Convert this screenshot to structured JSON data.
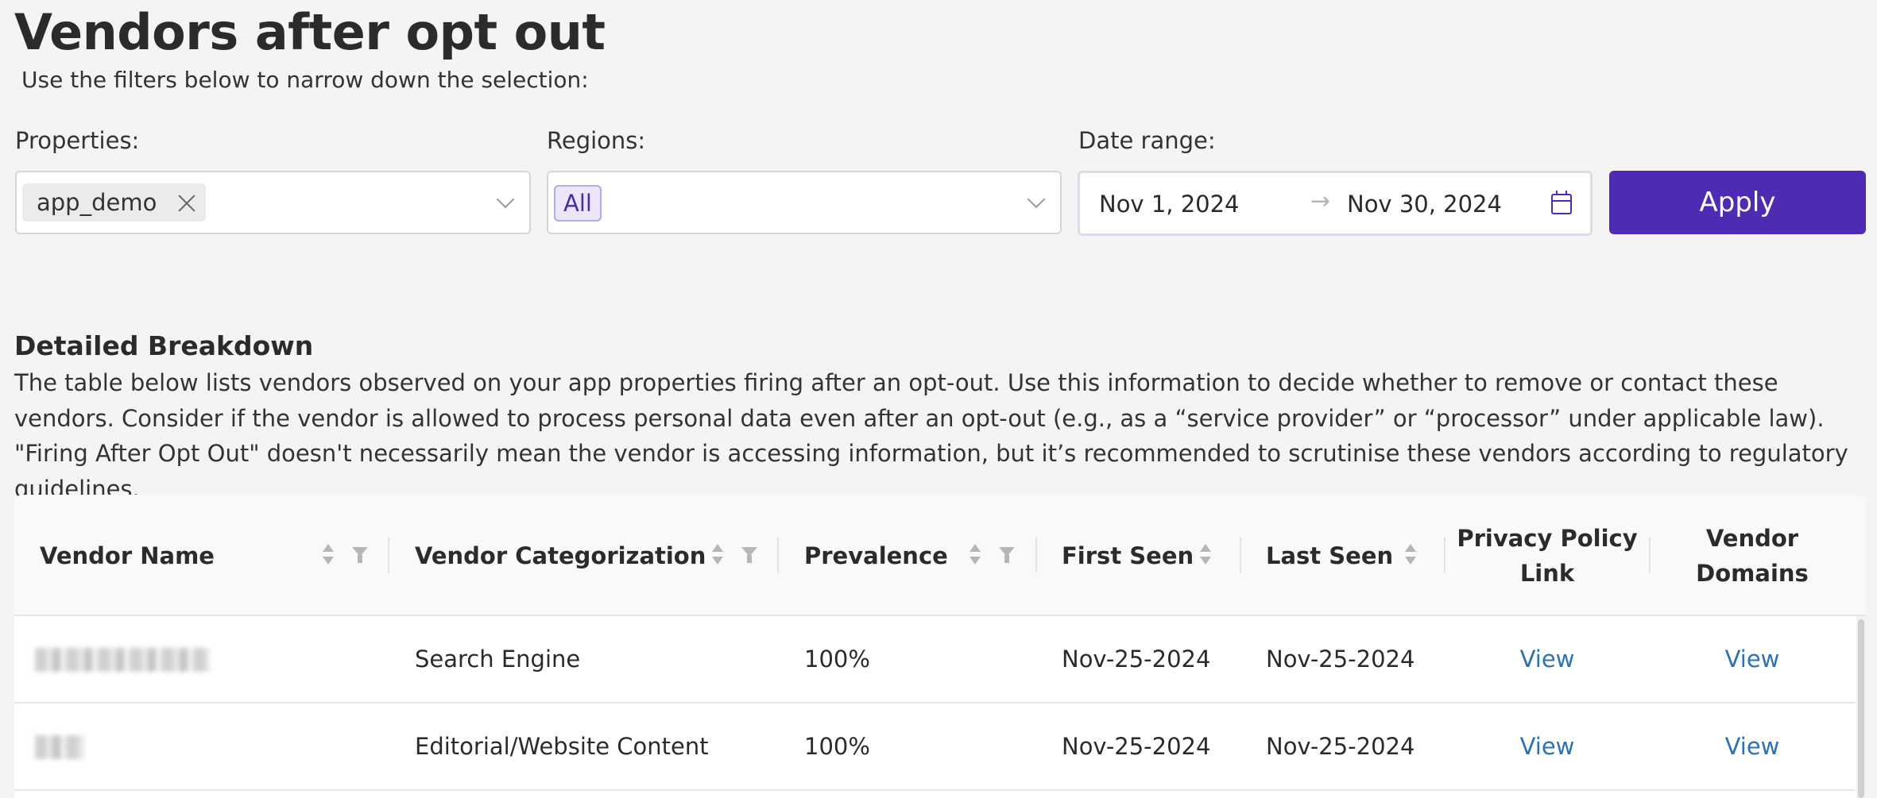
{
  "page": {
    "title": "Vendors after opt out",
    "subtitle": "Use the filters below to narrow down the selection:"
  },
  "filters": {
    "properties": {
      "label": "Properties:",
      "selected_tag": "app_demo"
    },
    "regions": {
      "label": "Regions:",
      "selected_tag": "All"
    },
    "date_range": {
      "label": "Date range:",
      "start": "Nov 1, 2024",
      "arrow": "→",
      "end": "Nov 30, 2024"
    },
    "apply_label": "Apply"
  },
  "breakdown": {
    "title": "Detailed Breakdown",
    "description": "The table below lists vendors observed on your app properties firing after an opt-out. Use this information to decide whether to remove or contact these vendors. Consider if the vendor is allowed to process personal data even after an opt-out (e.g., as a “service provider” or “processor” under applicable law). \"Firing After Opt Out\" doesn't necessarily mean the vendor is accessing information, but it’s recommended to scrutinise these vendors according to regulatory guidelines."
  },
  "table": {
    "columns": {
      "vendor_name": "Vendor Name",
      "categorization": "Vendor Categorization",
      "prevalence": "Prevalence",
      "first_seen": "First Seen",
      "last_seen": "Last Seen",
      "privacy_policy": "Privacy Policy Link",
      "vendor_domains": "Vendor Domains"
    },
    "rows": [
      {
        "categorization": "Search Engine",
        "prevalence": "100%",
        "first_seen": "Nov-25-2024",
        "last_seen": "Nov-25-2024",
        "privacy_policy": "View",
        "vendor_domains": "View"
      },
      {
        "categorization": "Editorial/Website Content",
        "prevalence": "100%",
        "first_seen": "Nov-25-2024",
        "last_seen": "Nov-25-2024",
        "privacy_policy": "View",
        "vendor_domains": "View"
      }
    ]
  },
  "colors": {
    "accent": "#4f2ab3",
    "link": "#2a72b5",
    "background": "#f4f4f4"
  },
  "icons": [
    "close-icon",
    "chevron-down-icon",
    "calendar-icon",
    "sort-icon",
    "filter-icon"
  ]
}
